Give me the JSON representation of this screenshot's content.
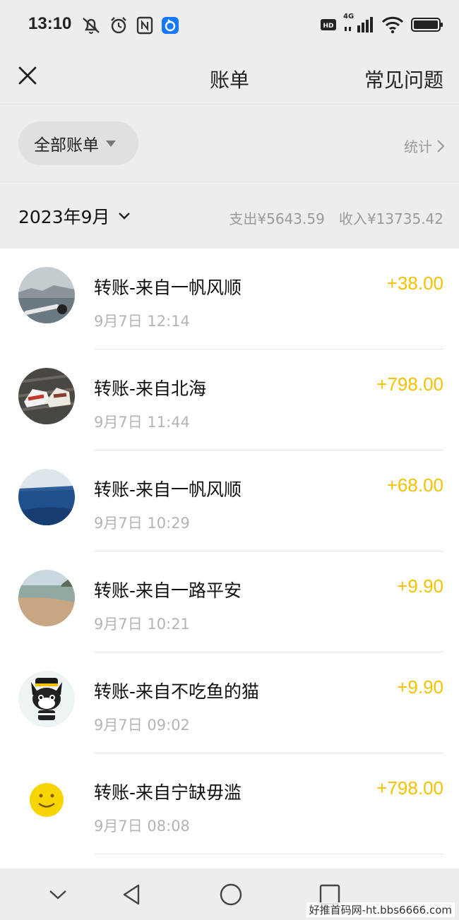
{
  "status": {
    "time": "13:10",
    "network": "4G"
  },
  "nav": {
    "title": "账单",
    "faq_label": "常见问题"
  },
  "filter": {
    "selected": "全部账单",
    "stats_label": "统计"
  },
  "month": {
    "label": "2023年9月",
    "expense": "支出¥5643.59",
    "income": "收入¥13735.42"
  },
  "transactions": [
    {
      "title": "转账-来自一帆风顺",
      "time": "9月7日 12:14",
      "amount": "+38.00",
      "avatar": "lake-photo"
    },
    {
      "title": "转账-来自北海",
      "time": "9月7日 11:44",
      "amount": "+798.00",
      "avatar": "sneakers-photo"
    },
    {
      "title": "转账-来自一帆风顺",
      "time": "9月7日 10:29",
      "amount": "+68.00",
      "avatar": "sea-photo"
    },
    {
      "title": "转账-来自一路平安",
      "time": "9月7日 10:21",
      "amount": "+9.90",
      "avatar": "beach-photo"
    },
    {
      "title": "转账-来自不吃鱼的猫",
      "time": "9月7日 09:02",
      "amount": "+9.90",
      "avatar": "cartoon-cat"
    },
    {
      "title": "转账-来自宁缺毋滥",
      "time": "9月7日 08:08",
      "amount": "+798.00",
      "avatar": "smiley-face"
    }
  ],
  "colors": {
    "amount": "#f2c200",
    "background": "#ededed"
  },
  "watermark": "好推首码网-ht.bbs6666.com"
}
